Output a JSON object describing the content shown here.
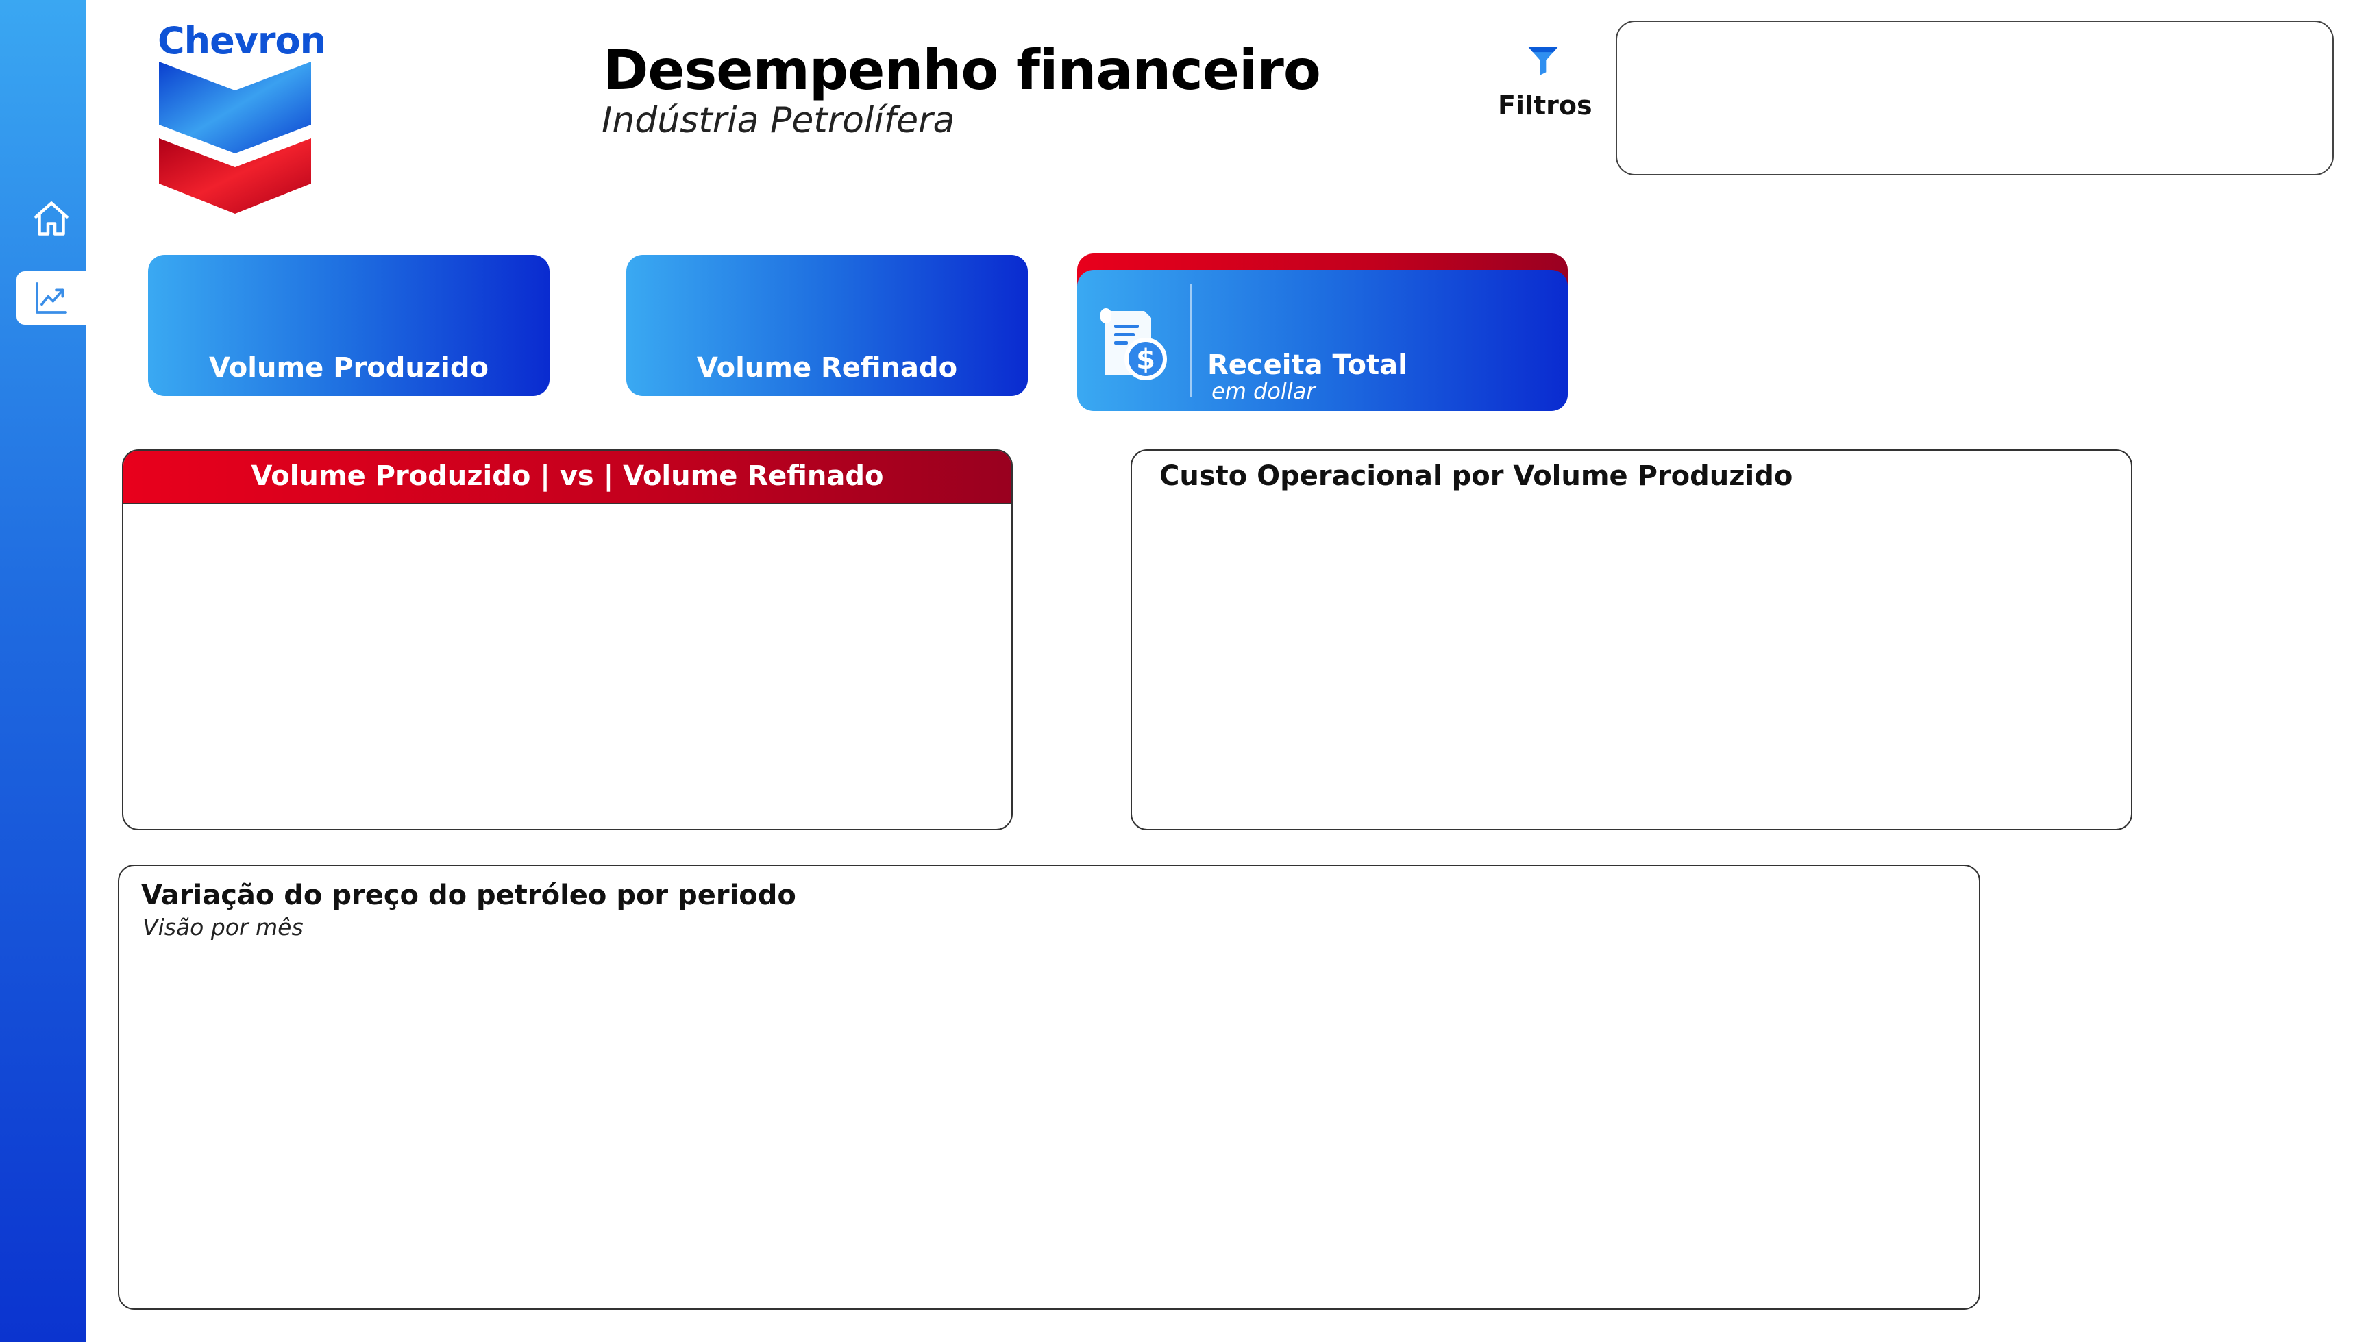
{
  "brand": {
    "name": "Chevron",
    "color_blue": "#0f53d6",
    "color_red": "#e8001c"
  },
  "header": {
    "title": "Desempenho financeiro",
    "subtitle": "Indústria Petrolífera"
  },
  "filters": {
    "label": "Filtros",
    "icon": "filter-icon"
  },
  "sidebar": {
    "items": [
      {
        "icon": "home-icon",
        "active": false
      },
      {
        "icon": "trending-chart-icon",
        "active": true
      }
    ]
  },
  "kpis": {
    "produced": {
      "label": "Volume Produzido"
    },
    "refined": {
      "label": "Volume Refinado"
    },
    "revenue": {
      "label": "Receita Total",
      "sublabel": "em dollar",
      "icon": "invoice-dollar-icon"
    }
  },
  "panels": {
    "vs": {
      "title": "Volume Produzido | vs | Volume Refinado"
    },
    "cost": {
      "title": "Custo Operacional por Volume Produzido"
    },
    "price": {
      "title": "Variação do preço do petróleo por periodo",
      "subtitle": "Visão por mês"
    }
  }
}
